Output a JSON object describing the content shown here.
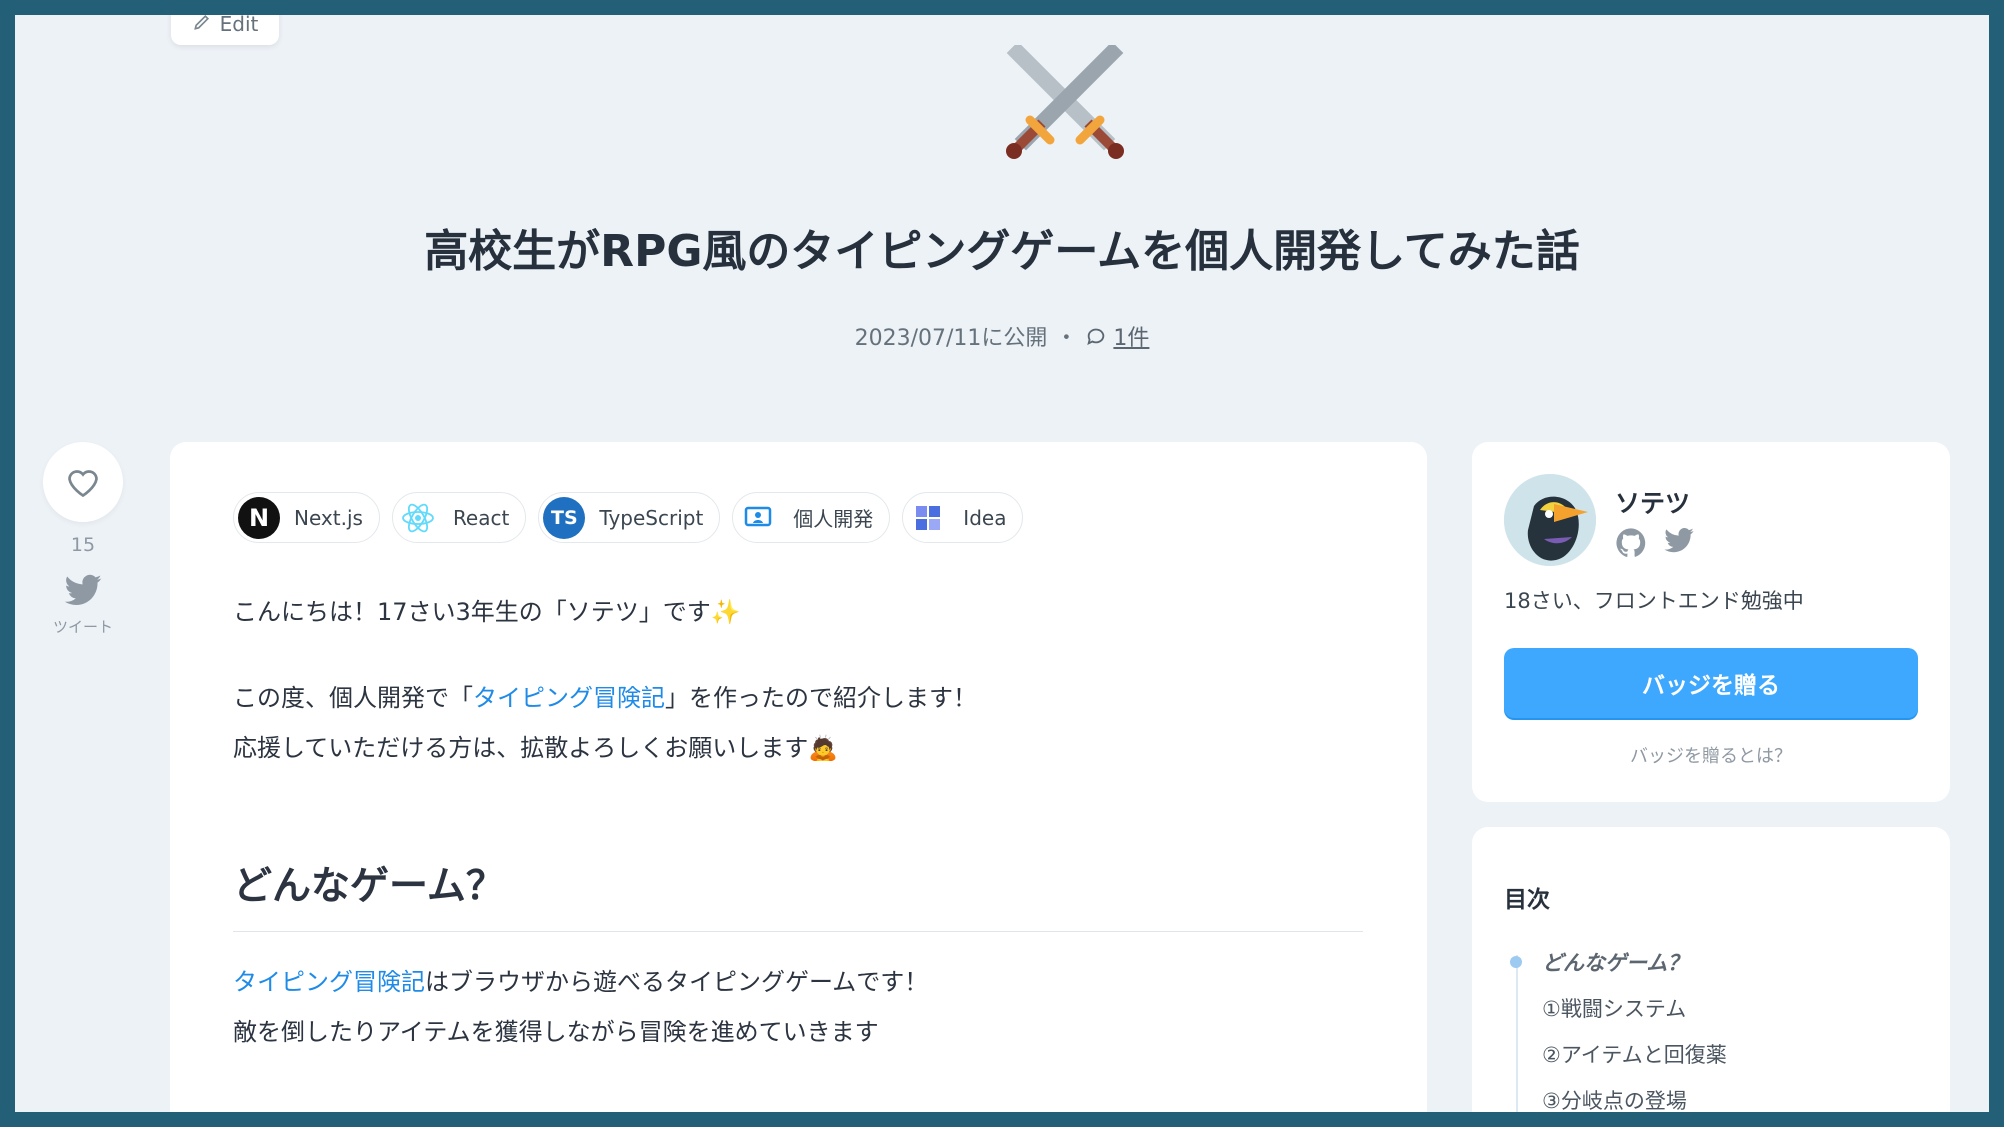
{
  "header": {
    "edit_label": "Edit",
    "emoji": "crossed-swords",
    "title": "高校生がRPG風のタイピングゲームを個人開発してみた話",
    "published": "2023/07/11に公開",
    "separator": "・",
    "comment_count": "1件"
  },
  "actions": {
    "like_count": "15",
    "tweet_label": "ツイート"
  },
  "topics": [
    {
      "label": "Next.js",
      "icon": "nextjs-icon"
    },
    {
      "label": "React",
      "icon": "react-icon"
    },
    {
      "label": "TypeScript",
      "icon": "typescript-icon"
    },
    {
      "label": "個人開発",
      "icon": "personal-dev-icon"
    },
    {
      "label": "Idea",
      "icon": "idea-icon"
    }
  ],
  "article": {
    "intro": "こんにちは！17さい3年生の「ソテツ」です",
    "p2_before": "この度、個人開発で「",
    "p2_link": "タイピング冒険記",
    "p2_after": "」を作ったので紹介します！",
    "p3": "応援していただける方は、拡散よろしくお願いします",
    "heading": "どんなゲーム？",
    "p4_link": "タイピング冒険記",
    "p4_after": "はブラウザから遊べるタイピングゲームです！",
    "p5": "敵を倒したりアイテムを獲得しながら冒険を進めていきます"
  },
  "profile": {
    "name": "ソテツ",
    "bio": "18さい、フロントエンド勉強中",
    "badge_button": "バッジを贈る",
    "badge_help": "バッジを贈るとは？"
  },
  "toc": {
    "title": "目次",
    "items": [
      "どんなゲーム？",
      "①戦闘システム",
      "②アイテムと回復薬",
      "③分岐点の登場"
    ]
  },
  "colors": {
    "accent": "#3ea8ff",
    "link": "#1f8be8",
    "background": "#edf2f7"
  }
}
